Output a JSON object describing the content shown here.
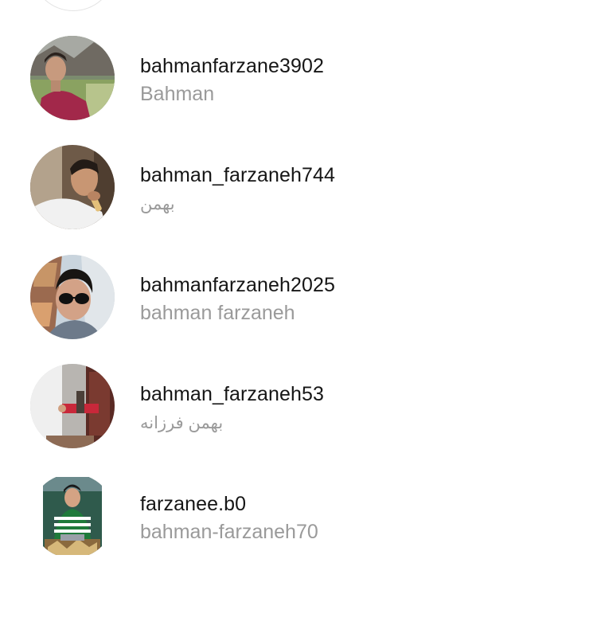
{
  "accounts": [
    {
      "username": "bahmanfarzane3902",
      "full_name": "Bahman",
      "rtl": false,
      "avatar_icon": "profile-photo-man-outdoors-red-shirt"
    },
    {
      "username": "bahman_farzaneh744",
      "full_name": "بهمن",
      "rtl": true,
      "avatar_icon": "profile-photo-man-white-tshirt"
    },
    {
      "username": "bahmanfarzaneh2025",
      "full_name": "bahman farzaneh",
      "rtl": false,
      "avatar_icon": "profile-photo-man-sunglasses"
    },
    {
      "username": "bahman_farzaneh53",
      "full_name": "بهمن فرزانه",
      "rtl": true,
      "avatar_icon": "profile-photo-room-interior"
    },
    {
      "username": "farzanee.b0",
      "full_name": "bahman-farzaneh70",
      "rtl": false,
      "avatar_icon": "profile-photo-man-green-jacket"
    }
  ],
  "colors": {
    "username": "#161616",
    "full_name": "#9a9a9a",
    "background": "#ffffff"
  }
}
